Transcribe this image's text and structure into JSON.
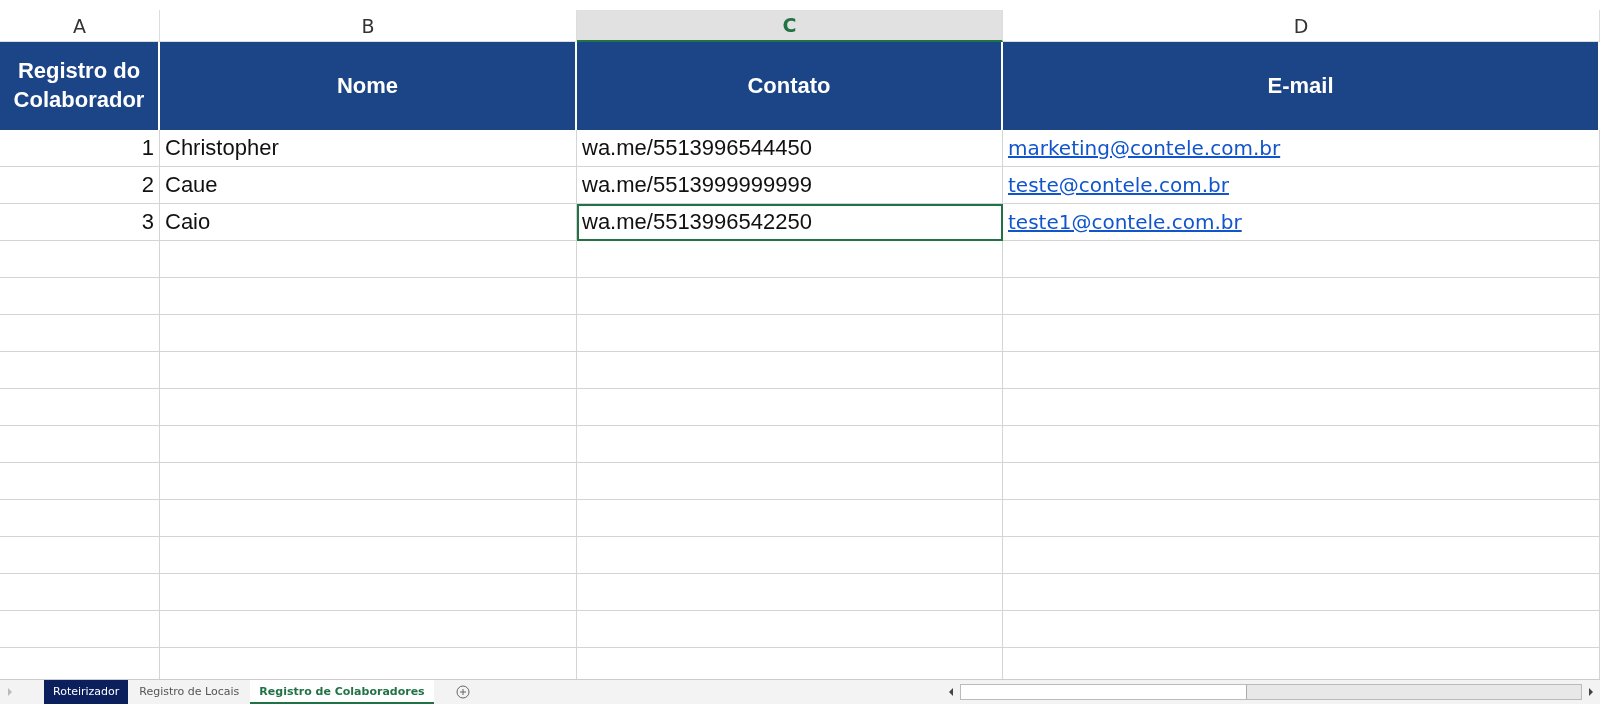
{
  "columns": [
    {
      "letter": "A",
      "selected": false
    },
    {
      "letter": "B",
      "selected": false
    },
    {
      "letter": "C",
      "selected": true
    },
    {
      "letter": "D",
      "selected": false
    }
  ],
  "header": [
    "Registro do Colaborador",
    "Nome",
    "Contato",
    "E-mail"
  ],
  "rows": [
    {
      "cells": [
        {
          "text": "1",
          "selected": false
        },
        {
          "text": "Christopher",
          "selected": false
        },
        {
          "text": "wa.me/5513996544450",
          "selected": false
        },
        {
          "text": "marketing@contele.com.br",
          "selected": false
        }
      ]
    },
    {
      "cells": [
        {
          "text": "2",
          "selected": false
        },
        {
          "text": "Caue",
          "selected": false
        },
        {
          "text": "wa.me/5513999999999",
          "selected": false
        },
        {
          "text": "teste@contele.com.br",
          "selected": false
        }
      ]
    },
    {
      "cells": [
        {
          "text": "3",
          "selected": false
        },
        {
          "text": "Caio",
          "selected": false
        },
        {
          "text": "wa.me/5513996542250",
          "selected": true
        },
        {
          "text": "teste1@contele.com.br",
          "selected": false
        }
      ]
    }
  ],
  "sheet_tabs": [
    {
      "label": "Roteirizador",
      "selected": false,
      "color": "#0b1f5c"
    },
    {
      "label": "Registro de Locais",
      "selected": false
    },
    {
      "label": "Registro de Colaboradores",
      "selected": true
    }
  ]
}
